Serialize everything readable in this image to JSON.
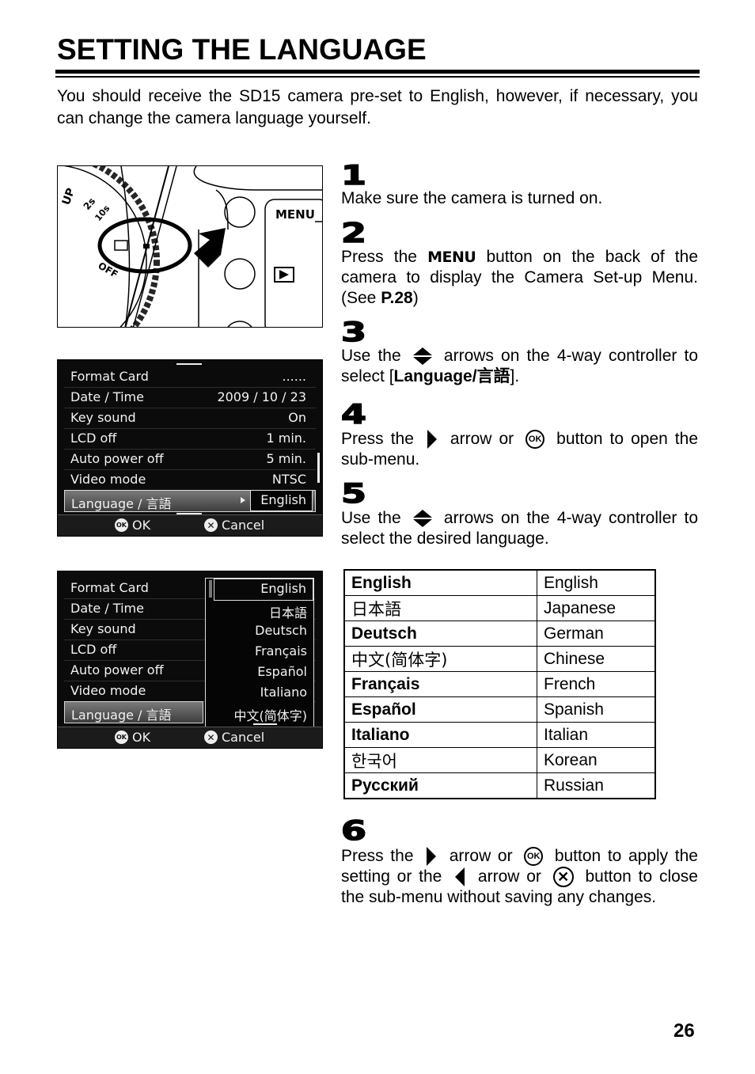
{
  "page": {
    "title": "SETTING THE LANGUAGE",
    "intro": "You should receive the SD15 camera pre-set to English, however, if necessary, you can change the camera language yourself.",
    "page_number": "26"
  },
  "camera_illustration": {
    "menu_label": "MENU",
    "dial_labels": [
      "UP",
      "2s",
      "10s",
      "OFF"
    ],
    "play_icon": "play-icon"
  },
  "menu_screen_1": {
    "rows": [
      {
        "label": "Format Card",
        "value": "......"
      },
      {
        "label": "Date / Time",
        "value": "2009 / 10 / 23"
      },
      {
        "label": "Key sound",
        "value": "On"
      },
      {
        "label": "LCD off",
        "value": "1 min."
      },
      {
        "label": "Auto power off",
        "value": "5 min."
      },
      {
        "label": "Video mode",
        "value": "NTSC"
      },
      {
        "label": "Language / 言語",
        "value": "English",
        "selected": true
      }
    ],
    "footer": {
      "ok_icon": "OK",
      "ok_label": "OK",
      "cancel_icon": "✕",
      "cancel_label": "Cancel"
    }
  },
  "menu_screen_2": {
    "rows": [
      {
        "label": "Format Card"
      },
      {
        "label": "Date / Time"
      },
      {
        "label": "Key sound"
      },
      {
        "label": "LCD off"
      },
      {
        "label": "Auto power off"
      },
      {
        "label": "Video mode"
      },
      {
        "label": "Language / 言語",
        "selected": true
      }
    ],
    "submenu_options": [
      "English",
      "日本語",
      "Deutsch",
      "Français",
      "Español",
      "Italiano",
      "中文(简体字)"
    ],
    "footer": {
      "ok_icon": "OK",
      "ok_label": "OK",
      "cancel_icon": "✕",
      "cancel_label": "Cancel"
    }
  },
  "steps": [
    {
      "number": "1",
      "text": "Make sure the camera is turned on."
    },
    {
      "number": "2",
      "text_a": "Press the ",
      "menu_glyph": "MENU",
      "text_b": " button on the back of the camera to display the Camera Set-up Menu. (See ",
      "ref": "P.28",
      "text_c": ")"
    },
    {
      "number": "3",
      "text_a": "Use the ",
      "text_b": " arrows on the 4-way controller to select [",
      "bold": "Language/言語",
      "text_c": "]."
    },
    {
      "number": "4",
      "text_a": "Press the ",
      "text_b": " arrow or ",
      "ok_label": "OK",
      "text_c": " button to open the sub-menu."
    },
    {
      "number": "5",
      "text_a": "Use the ",
      "text_b": " arrows on the 4-way controller to select the desired language."
    },
    {
      "number": "6",
      "text_a": "Press the ",
      "text_b": " arrow or ",
      "ok_label": "OK",
      "text_c": " button to apply the setting or the ",
      "text_d": " arrow or ",
      "x_label": "✕",
      "text_e": " button to close the sub-menu without saving any changes."
    }
  ],
  "language_table": [
    {
      "native": "English",
      "english": "English"
    },
    {
      "native": "日本語",
      "english": "Japanese"
    },
    {
      "native": "Deutsch",
      "english": "German"
    },
    {
      "native": "中文(简体字)",
      "english": "Chinese"
    },
    {
      "native": "Français",
      "english": "French"
    },
    {
      "native": "Español",
      "english": "Spanish"
    },
    {
      "native": "Italiano",
      "english": "Italian"
    },
    {
      "native": "한국어",
      "english": "Korean"
    },
    {
      "native": "Русский",
      "english": "Russian"
    }
  ]
}
